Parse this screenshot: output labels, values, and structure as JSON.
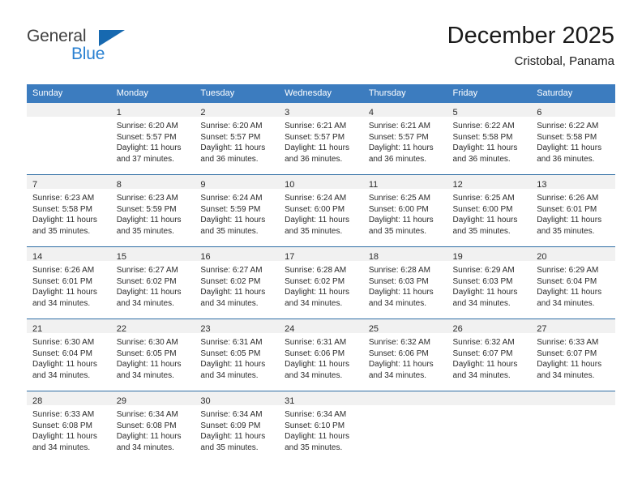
{
  "brand": {
    "name_top": "General",
    "name_bottom": "Blue",
    "triangle_color": "#1769b0",
    "blue_color": "#2980d1"
  },
  "header": {
    "title": "December 2025",
    "subtitle": "Cristobal, Panama"
  },
  "theme": {
    "header_bg": "#3c7cbf",
    "row_divider": "#2e6da4",
    "daynum_band": "#f1f1f1",
    "text": "#2b2b2b"
  },
  "weekdays": [
    "Sunday",
    "Monday",
    "Tuesday",
    "Wednesday",
    "Thursday",
    "Friday",
    "Saturday"
  ],
  "weeks": [
    [
      {
        "day": "",
        "lines": []
      },
      {
        "day": "1",
        "lines": [
          "Sunrise: 6:20 AM",
          "Sunset: 5:57 PM",
          "Daylight: 11 hours",
          "and 37 minutes."
        ]
      },
      {
        "day": "2",
        "lines": [
          "Sunrise: 6:20 AM",
          "Sunset: 5:57 PM",
          "Daylight: 11 hours",
          "and 36 minutes."
        ]
      },
      {
        "day": "3",
        "lines": [
          "Sunrise: 6:21 AM",
          "Sunset: 5:57 PM",
          "Daylight: 11 hours",
          "and 36 minutes."
        ]
      },
      {
        "day": "4",
        "lines": [
          "Sunrise: 6:21 AM",
          "Sunset: 5:57 PM",
          "Daylight: 11 hours",
          "and 36 minutes."
        ]
      },
      {
        "day": "5",
        "lines": [
          "Sunrise: 6:22 AM",
          "Sunset: 5:58 PM",
          "Daylight: 11 hours",
          "and 36 minutes."
        ]
      },
      {
        "day": "6",
        "lines": [
          "Sunrise: 6:22 AM",
          "Sunset: 5:58 PM",
          "Daylight: 11 hours",
          "and 36 minutes."
        ]
      }
    ],
    [
      {
        "day": "7",
        "lines": [
          "Sunrise: 6:23 AM",
          "Sunset: 5:58 PM",
          "Daylight: 11 hours",
          "and 35 minutes."
        ]
      },
      {
        "day": "8",
        "lines": [
          "Sunrise: 6:23 AM",
          "Sunset: 5:59 PM",
          "Daylight: 11 hours",
          "and 35 minutes."
        ]
      },
      {
        "day": "9",
        "lines": [
          "Sunrise: 6:24 AM",
          "Sunset: 5:59 PM",
          "Daylight: 11 hours",
          "and 35 minutes."
        ]
      },
      {
        "day": "10",
        "lines": [
          "Sunrise: 6:24 AM",
          "Sunset: 6:00 PM",
          "Daylight: 11 hours",
          "and 35 minutes."
        ]
      },
      {
        "day": "11",
        "lines": [
          "Sunrise: 6:25 AM",
          "Sunset: 6:00 PM",
          "Daylight: 11 hours",
          "and 35 minutes."
        ]
      },
      {
        "day": "12",
        "lines": [
          "Sunrise: 6:25 AM",
          "Sunset: 6:00 PM",
          "Daylight: 11 hours",
          "and 35 minutes."
        ]
      },
      {
        "day": "13",
        "lines": [
          "Sunrise: 6:26 AM",
          "Sunset: 6:01 PM",
          "Daylight: 11 hours",
          "and 35 minutes."
        ]
      }
    ],
    [
      {
        "day": "14",
        "lines": [
          "Sunrise: 6:26 AM",
          "Sunset: 6:01 PM",
          "Daylight: 11 hours",
          "and 34 minutes."
        ]
      },
      {
        "day": "15",
        "lines": [
          "Sunrise: 6:27 AM",
          "Sunset: 6:02 PM",
          "Daylight: 11 hours",
          "and 34 minutes."
        ]
      },
      {
        "day": "16",
        "lines": [
          "Sunrise: 6:27 AM",
          "Sunset: 6:02 PM",
          "Daylight: 11 hours",
          "and 34 minutes."
        ]
      },
      {
        "day": "17",
        "lines": [
          "Sunrise: 6:28 AM",
          "Sunset: 6:02 PM",
          "Daylight: 11 hours",
          "and 34 minutes."
        ]
      },
      {
        "day": "18",
        "lines": [
          "Sunrise: 6:28 AM",
          "Sunset: 6:03 PM",
          "Daylight: 11 hours",
          "and 34 minutes."
        ]
      },
      {
        "day": "19",
        "lines": [
          "Sunrise: 6:29 AM",
          "Sunset: 6:03 PM",
          "Daylight: 11 hours",
          "and 34 minutes."
        ]
      },
      {
        "day": "20",
        "lines": [
          "Sunrise: 6:29 AM",
          "Sunset: 6:04 PM",
          "Daylight: 11 hours",
          "and 34 minutes."
        ]
      }
    ],
    [
      {
        "day": "21",
        "lines": [
          "Sunrise: 6:30 AM",
          "Sunset: 6:04 PM",
          "Daylight: 11 hours",
          "and 34 minutes."
        ]
      },
      {
        "day": "22",
        "lines": [
          "Sunrise: 6:30 AM",
          "Sunset: 6:05 PM",
          "Daylight: 11 hours",
          "and 34 minutes."
        ]
      },
      {
        "day": "23",
        "lines": [
          "Sunrise: 6:31 AM",
          "Sunset: 6:05 PM",
          "Daylight: 11 hours",
          "and 34 minutes."
        ]
      },
      {
        "day": "24",
        "lines": [
          "Sunrise: 6:31 AM",
          "Sunset: 6:06 PM",
          "Daylight: 11 hours",
          "and 34 minutes."
        ]
      },
      {
        "day": "25",
        "lines": [
          "Sunrise: 6:32 AM",
          "Sunset: 6:06 PM",
          "Daylight: 11 hours",
          "and 34 minutes."
        ]
      },
      {
        "day": "26",
        "lines": [
          "Sunrise: 6:32 AM",
          "Sunset: 6:07 PM",
          "Daylight: 11 hours",
          "and 34 minutes."
        ]
      },
      {
        "day": "27",
        "lines": [
          "Sunrise: 6:33 AM",
          "Sunset: 6:07 PM",
          "Daylight: 11 hours",
          "and 34 minutes."
        ]
      }
    ],
    [
      {
        "day": "28",
        "lines": [
          "Sunrise: 6:33 AM",
          "Sunset: 6:08 PM",
          "Daylight: 11 hours",
          "and 34 minutes."
        ]
      },
      {
        "day": "29",
        "lines": [
          "Sunrise: 6:34 AM",
          "Sunset: 6:08 PM",
          "Daylight: 11 hours",
          "and 34 minutes."
        ]
      },
      {
        "day": "30",
        "lines": [
          "Sunrise: 6:34 AM",
          "Sunset: 6:09 PM",
          "Daylight: 11 hours",
          "and 35 minutes."
        ]
      },
      {
        "day": "31",
        "lines": [
          "Sunrise: 6:34 AM",
          "Sunset: 6:10 PM",
          "Daylight: 11 hours",
          "and 35 minutes."
        ]
      },
      {
        "day": "",
        "lines": []
      },
      {
        "day": "",
        "lines": []
      },
      {
        "day": "",
        "lines": []
      }
    ]
  ]
}
